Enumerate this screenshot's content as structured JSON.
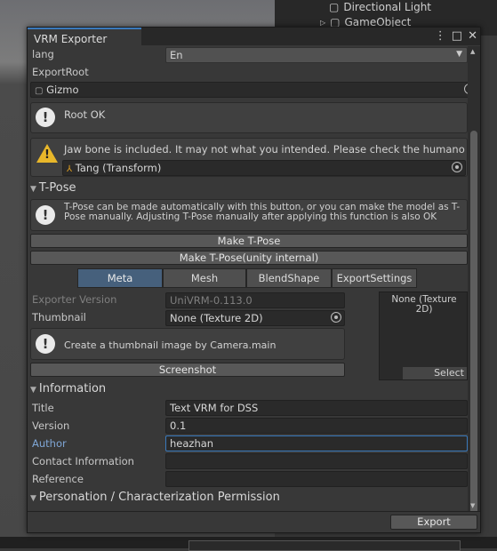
{
  "background": {
    "hierarchy_items": [
      "Directional Light",
      "GameObject"
    ]
  },
  "window": {
    "title": "VRM Exporter",
    "footer_export_label": "Export"
  },
  "lang": {
    "label": "lang",
    "value": "En"
  },
  "export_root": {
    "label": "ExportRoot",
    "value": "Gizmo"
  },
  "messages": {
    "root_ok": "Root OK",
    "jaw_warning": "Jaw bone is included. It may not what you intended. Please check the humano",
    "jaw_object": "Tang (Transform)"
  },
  "tpose": {
    "header": "T-Pose",
    "help": "T-Pose can be made automatically with this button, or you can make the model as T-Pose manually. Adjusting T-Pose manually after applying this function is also OK",
    "make_button": "Make T-Pose",
    "make_internal_button": "Make T-Pose(unity internal)"
  },
  "tabs": [
    {
      "label": "Meta",
      "active": true
    },
    {
      "label": "Mesh",
      "active": false
    },
    {
      "label": "BlendShape",
      "active": false
    },
    {
      "label": "ExportSettings",
      "active": false
    }
  ],
  "meta": {
    "exporter_version_label": "Exporter Version",
    "exporter_version_value": "UniVRM-0.113.0",
    "thumbnail_label": "Thumbnail",
    "thumbnail_value": "None (Texture 2D)",
    "thumbnail_help": "Create a thumbnail image by Camera.main",
    "screenshot_button": "Screenshot",
    "preview_text": "None (Texture 2D)",
    "select_button": "Select"
  },
  "information": {
    "header": "Information",
    "fields": [
      {
        "label": "Title",
        "value": "Text VRM for DSS"
      },
      {
        "label": "Version",
        "value": "0.1"
      },
      {
        "label": "Author",
        "value": "heazhan"
      },
      {
        "label": "Contact Information",
        "value": ""
      },
      {
        "label": "Reference",
        "value": ""
      }
    ]
  },
  "permission": {
    "header": "Personation / Characterization Permission"
  },
  "colors": {
    "accent": "#3a79bb",
    "active_tab": "#46607c",
    "warning": "#e8b72a"
  }
}
